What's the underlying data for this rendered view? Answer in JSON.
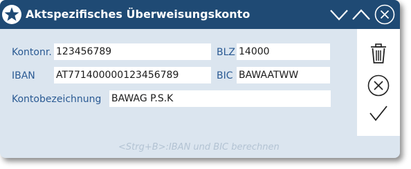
{
  "window": {
    "title": "Aktspezifisches Überweisungskonto",
    "icon": "star-icon",
    "controls": [
      "collapse-icon",
      "expand-icon",
      "close-icon"
    ]
  },
  "form": {
    "kontonr": {
      "label": "Kontonr.",
      "value": "123456789"
    },
    "blz": {
      "label": "BLZ",
      "value": "14000"
    },
    "iban": {
      "label": "IBAN",
      "value": "AT771400000123456789"
    },
    "bic": {
      "label": "BIC",
      "value": "BAWAATWW"
    },
    "kontobezeichnung": {
      "label": "Kontobezeichnung",
      "value": "BAWAG P.S.K"
    }
  },
  "side_actions": [
    "trash-icon",
    "cancel-icon",
    "confirm-check-icon"
  ],
  "hint": "<Strg+B>:IBAN und BIC berechnen",
  "colors": {
    "titlebar": "#1f4a74",
    "background": "#dbe5ef",
    "label": "#2a5a93",
    "hint": "#b3c3d3"
  }
}
